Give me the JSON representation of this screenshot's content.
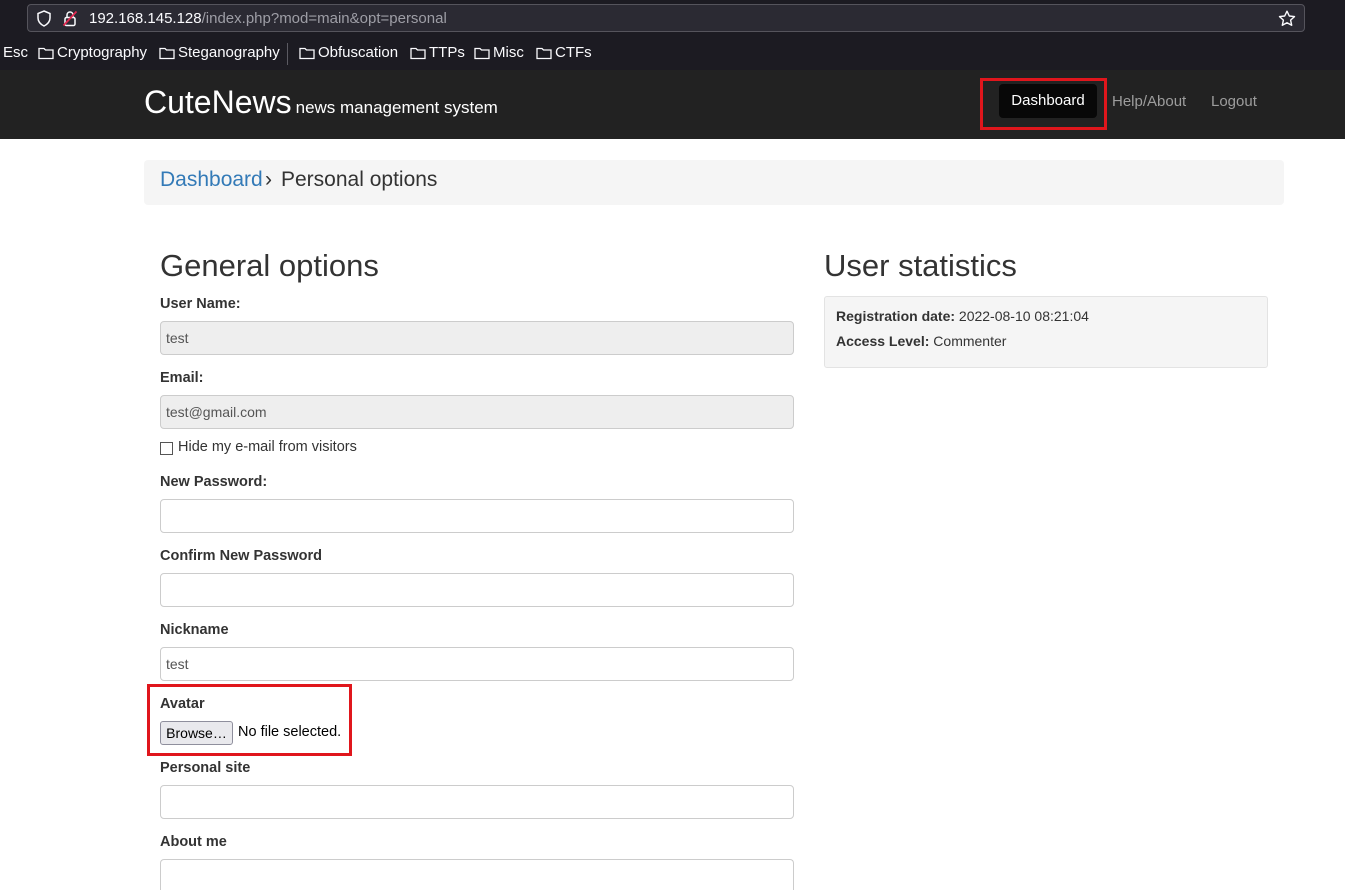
{
  "browser": {
    "url_host": "192.168.145.128",
    "url_path": "/index.php?mod=main&opt=personal",
    "bookmarks": [
      "Esc",
      "Cryptography",
      "Steganography",
      "Obfuscation",
      "TTPs",
      "Misc",
      "CTFs"
    ]
  },
  "site": {
    "brand": "CuteNews",
    "brand_sub": "news management system",
    "nav": {
      "dashboard": "Dashboard",
      "help": "Help/About",
      "logout": "Logout"
    }
  },
  "breadcrumb": {
    "link": "Dashboard",
    "separator": "›",
    "current": "Personal options"
  },
  "general": {
    "heading": "General options",
    "username_label": "User Name:",
    "username_value": "test",
    "email_label": "Email:",
    "email_value": "test@gmail.com",
    "hide_email_label": "Hide my e-mail from visitors",
    "new_password_label": "New Password:",
    "confirm_password_label": "Confirm New Password",
    "nickname_label": "Nickname",
    "nickname_value": "test",
    "avatar_label": "Avatar",
    "browse_label": "Browse…",
    "no_file_label": "No file selected.",
    "personal_site_label": "Personal site",
    "about_label": "About me"
  },
  "stats": {
    "heading": "User statistics",
    "registration_label": "Registration date:",
    "registration_value": "2022-08-10 08:21:04",
    "access_label": "Access Level:",
    "access_value": "Commenter"
  },
  "colors": {
    "highlight": "#e0161c",
    "link": "#337ab7",
    "navbar": "#222222"
  }
}
